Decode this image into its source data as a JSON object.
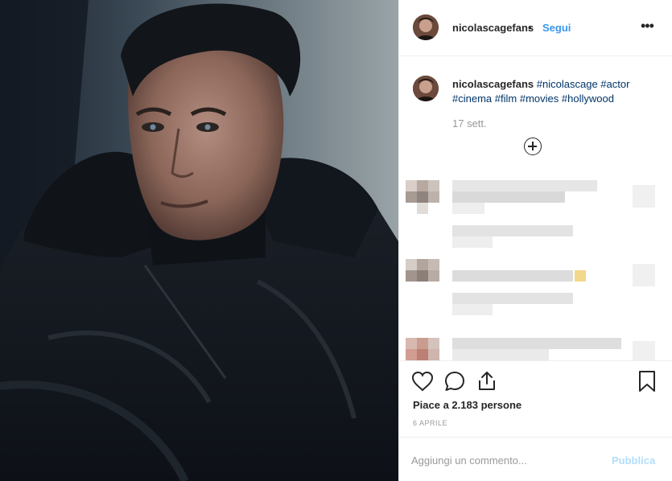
{
  "post": {
    "username": "nicolascagefans",
    "follow_label": "Segui",
    "separator": "•",
    "more_label": "•••",
    "caption": {
      "username": "nicolascagefans",
      "hashtags": [
        "#nicolascage",
        "#actor",
        "#cinema",
        "#film",
        "#movies",
        "#hollywood"
      ]
    },
    "caption_time": "17 sett.",
    "likes_text": "Piace a 2.183 persone",
    "date": "6 APRILE",
    "comment_placeholder": "Aggiungi un commento...",
    "publish_label": "Pubblica"
  },
  "colors": {
    "accent": "#3897f0",
    "hashtag": "#003569",
    "publish_disabled": "#b2dffc"
  }
}
